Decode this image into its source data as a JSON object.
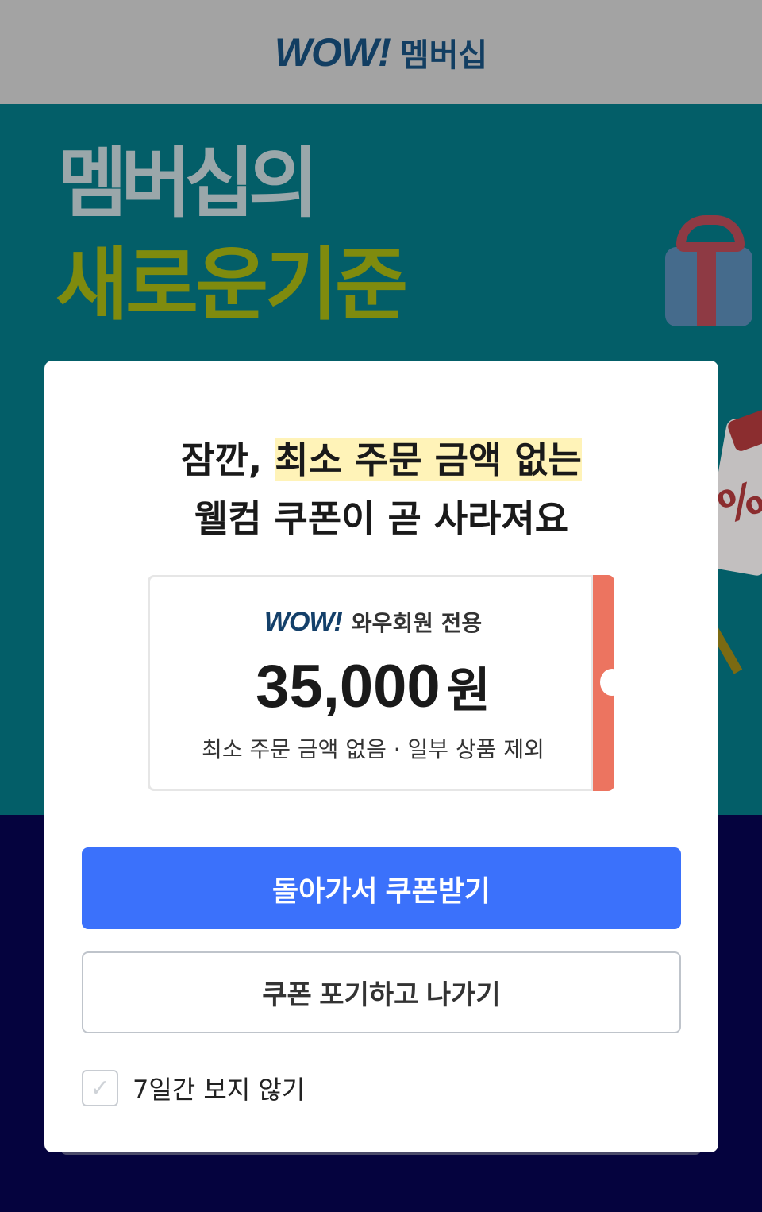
{
  "header": {
    "logo": "WOW!",
    "title": "멤버십"
  },
  "banner": {
    "line1": "멤버십의",
    "line2": "새로운기준",
    "tag_symbol": "%"
  },
  "modal": {
    "title_prefix": "잠깐, ",
    "title_highlight": "최소 주문 금액 없는",
    "title_line2": "웰컴 쿠폰이 곧 사라져요",
    "coupon": {
      "logo": "WOW!",
      "only_label": "와우회원 전용",
      "amount": "35,000",
      "unit": "원",
      "conditions": "최소 주문 금액 없음 · 일부 상품 제외"
    },
    "primary_button": "돌아가서 쿠폰받기",
    "secondary_button": "쿠폰 포기하고 나가기",
    "checkbox_label": "7일간 보지 않기",
    "checkbox_checked": false
  },
  "colors": {
    "primary": "#3b71fb",
    "coupon_accent": "#ec7460",
    "highlight": "#fff3b8",
    "banner_bg": "#035e68",
    "page_bg": "#05033e"
  }
}
